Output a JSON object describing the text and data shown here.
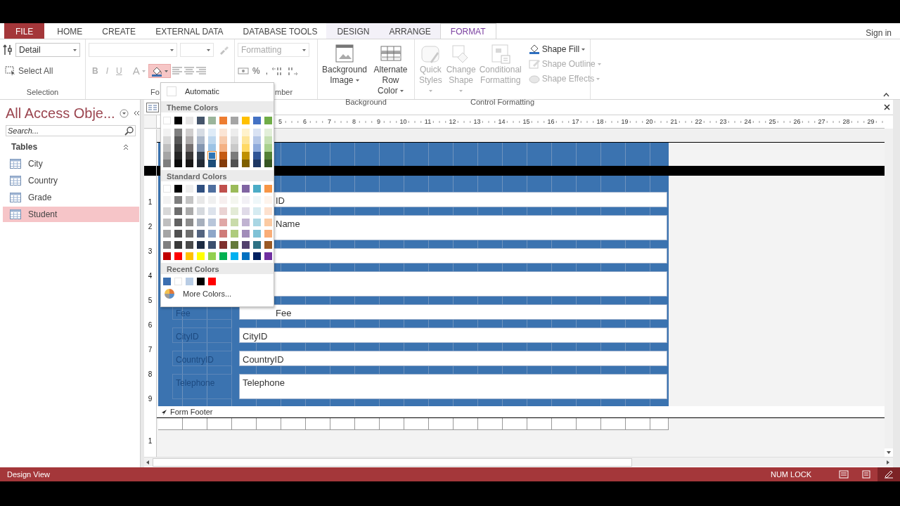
{
  "tabs": [
    {
      "label": "FILE",
      "kind": "file",
      "selected": false
    },
    {
      "label": "HOME",
      "kind": "main",
      "selected": false
    },
    {
      "label": "CREATE",
      "kind": "main",
      "selected": false
    },
    {
      "label": "EXTERNAL DATA",
      "kind": "main",
      "selected": false
    },
    {
      "label": "DATABASE TOOLS",
      "kind": "main",
      "selected": false
    },
    {
      "label": "DESIGN",
      "kind": "contextual",
      "selected": false
    },
    {
      "label": "ARRANGE",
      "kind": "contextual",
      "selected": false
    },
    {
      "label": "FORMAT",
      "kind": "contextual",
      "selected": true
    }
  ],
  "sign_in": "Sign in",
  "ribbon": {
    "selection": {
      "object": "Detail",
      "select_all": "Select All",
      "label": "Selection"
    },
    "font": {
      "label": "Fo",
      "disabled": true,
      "bold": "B",
      "italic": "I",
      "underline": "U",
      "font_color": "A",
      "fill_color_expanded": true
    },
    "number": {
      "label": "mber",
      "format_placeholder": "Formatting",
      "percent": "%",
      "comma": ","
    },
    "background": {
      "label": "Background",
      "buttons": [
        {
          "label": "Background Image"
        },
        {
          "label": "Alternate Row Color"
        }
      ]
    },
    "control_formatting": {
      "label": "Control Formatting",
      "large": [
        {
          "label": "Quick Styles",
          "disabled": true
        },
        {
          "label": "Change Shape",
          "disabled": true
        },
        {
          "label": "Conditional Formatting",
          "disabled": true
        }
      ],
      "small": [
        {
          "label": "Shape Fill",
          "disabled": false
        },
        {
          "label": "Shape Outline",
          "disabled": true
        },
        {
          "label": "Shape Effects",
          "disabled": true
        }
      ]
    }
  },
  "nav": {
    "title": "All Access Obje...",
    "search_placeholder": "Search...",
    "group": "Tables",
    "items": [
      {
        "label": "City",
        "selected": false
      },
      {
        "label": "Country",
        "selected": false
      },
      {
        "label": "Grade",
        "selected": false
      },
      {
        "label": "Student",
        "selected": true
      }
    ]
  },
  "designer": {
    "ruler_numbers": [
      "5",
      "6",
      "7",
      "8",
      "9",
      "10",
      "11",
      "12",
      "13",
      "14",
      "15",
      "16",
      "17",
      "18",
      "19",
      "20",
      "21",
      "22",
      "23",
      "24",
      "25",
      "26",
      "27",
      "28",
      "29"
    ],
    "vertical_ruler_detail": [
      "1",
      "2",
      "3",
      "4",
      "5",
      "6",
      "7",
      "8",
      "9"
    ],
    "vertical_ruler_footer": [
      "1"
    ],
    "fields": [
      {
        "kind": "text-box",
        "value": "ID"
      },
      {
        "kind": "text-box",
        "value": "Name"
      },
      {
        "kind": "text-box"
      },
      {
        "kind": "text-box"
      },
      {
        "kind": "text-box",
        "label": "Fee",
        "value": "Fee"
      },
      {
        "kind": "text-box",
        "label": "CityID",
        "value": "CityID"
      },
      {
        "kind": "text-box",
        "label": "CountryID",
        "value": "CountryID"
      },
      {
        "kind": "text-box",
        "label": "Telephone",
        "value": "Telephone"
      }
    ],
    "footer_label": "Form Footer"
  },
  "color_menu": {
    "automatic": "Automatic",
    "theme_heading": "Theme Colors",
    "theme_colors": [
      [
        {
          "color": "#ffffff",
          "selected": false
        },
        {
          "color": "#000000",
          "selected": false
        },
        {
          "color": "#e7e6e6",
          "selected": false
        },
        {
          "color": "#44546a",
          "selected": false
        },
        {
          "color": "#9bb59b",
          "selected": false
        },
        {
          "color": "#ed7d31",
          "selected": false
        },
        {
          "color": "#a5a5a5",
          "selected": false
        },
        {
          "color": "#ffc000",
          "selected": false
        },
        {
          "color": "#4472c4",
          "selected": false
        },
        {
          "color": "#70ad47",
          "selected": false
        }
      ],
      [
        {
          "color": "#f2f2f2",
          "selected": false
        },
        {
          "color": "#7f7f7f",
          "selected": false
        },
        {
          "color": "#d0cece",
          "selected": false
        },
        {
          "color": "#d6dce4",
          "selected": false
        },
        {
          "color": "#deebf7",
          "selected": false
        },
        {
          "color": "#fbe5d5",
          "selected": false
        },
        {
          "color": "#ededed",
          "selected": false
        },
        {
          "color": "#fff2cc",
          "selected": false
        },
        {
          "color": "#d9e2f3",
          "selected": false
        },
        {
          "color": "#e2efd9",
          "selected": false
        }
      ],
      [
        {
          "color": "#d9d9d9",
          "selected": false
        },
        {
          "color": "#595959",
          "selected": false
        },
        {
          "color": "#aeabab",
          "selected": false
        },
        {
          "color": "#adb9ca",
          "selected": false
        },
        {
          "color": "#bdd7ee",
          "selected": false
        },
        {
          "color": "#f7cbac",
          "selected": false
        },
        {
          "color": "#dbdbdb",
          "selected": false
        },
        {
          "color": "#fee599",
          "selected": false
        },
        {
          "color": "#b4c6e7",
          "selected": false
        },
        {
          "color": "#c5e0b3",
          "selected": false
        }
      ],
      [
        {
          "color": "#bfbfbf",
          "selected": false
        },
        {
          "color": "#3f3f3f",
          "selected": false
        },
        {
          "color": "#757070",
          "selected": false
        },
        {
          "color": "#8496b0",
          "selected": false
        },
        {
          "color": "#9cc3e5",
          "selected": false
        },
        {
          "color": "#f4b183",
          "selected": false
        },
        {
          "color": "#c9c9c9",
          "selected": false
        },
        {
          "color": "#ffd965",
          "selected": false
        },
        {
          "color": "#8eaadb",
          "selected": false
        },
        {
          "color": "#a8d08d",
          "selected": false
        }
      ],
      [
        {
          "color": "#a5a5a5",
          "selected": false
        },
        {
          "color": "#262626",
          "selected": false
        },
        {
          "color": "#3a3838",
          "selected": false
        },
        {
          "color": "#323f4f",
          "selected": false
        },
        {
          "color": "#2e75b5",
          "selected": true
        },
        {
          "color": "#c55a11",
          "selected": false
        },
        {
          "color": "#7b7b7b",
          "selected": false
        },
        {
          "color": "#bf9000",
          "selected": false
        },
        {
          "color": "#2f5496",
          "selected": false
        },
        {
          "color": "#538135",
          "selected": false
        }
      ],
      [
        {
          "color": "#7f7f7f",
          "selected": false
        },
        {
          "color": "#0c0c0c",
          "selected": false
        },
        {
          "color": "#171616",
          "selected": false
        },
        {
          "color": "#222a35",
          "selected": false
        },
        {
          "color": "#1e4e79",
          "selected": false
        },
        {
          "color": "#833c0b",
          "selected": false
        },
        {
          "color": "#525252",
          "selected": false
        },
        {
          "color": "#7f6000",
          "selected": false
        },
        {
          "color": "#1f3864",
          "selected": false
        },
        {
          "color": "#375623",
          "selected": false
        }
      ]
    ],
    "standard_heading": "Standard Colors",
    "standard_colors": [
      [
        {
          "color": "#ffffff"
        },
        {
          "color": "#000000"
        },
        {
          "color": "#eeeeee"
        },
        {
          "color": "#2f4f7f"
        },
        {
          "color": "#4f6f9f"
        },
        {
          "color": "#c0504d"
        },
        {
          "color": "#9bbb59"
        },
        {
          "color": "#8064a2"
        },
        {
          "color": "#4bacc6"
        },
        {
          "color": "#f79646"
        }
      ],
      [
        {
          "color": "#f2f2f2"
        },
        {
          "color": "#7f7f7f"
        },
        {
          "color": "#c4c4c4"
        },
        {
          "color": "#e8e8e8"
        },
        {
          "color": "#f0f0f0"
        },
        {
          "color": "#f7efef"
        },
        {
          "color": "#f4f6ef"
        },
        {
          "color": "#f2f0f5"
        },
        {
          "color": "#eef7f9"
        },
        {
          "color": "#fef4ec"
        }
      ],
      [
        {
          "color": "#d8d8d8"
        },
        {
          "color": "#6e6e6e"
        },
        {
          "color": "#aaaaaa"
        },
        {
          "color": "#d5d9de"
        },
        {
          "color": "#dde3ec"
        },
        {
          "color": "#ead3d3"
        },
        {
          "color": "#e3ebd6"
        },
        {
          "color": "#e0dbe8"
        },
        {
          "color": "#d5ebf1"
        },
        {
          "color": "#fde1ce"
        }
      ],
      [
        {
          "color": "#bfbfbf"
        },
        {
          "color": "#626262"
        },
        {
          "color": "#8c8c8c"
        },
        {
          "color": "#a6afbc"
        },
        {
          "color": "#b8c6da"
        },
        {
          "color": "#dfa7a6"
        },
        {
          "color": "#c9dbaa"
        },
        {
          "color": "#c0b3d1"
        },
        {
          "color": "#a9d6e3"
        },
        {
          "color": "#fbcaa2"
        }
      ],
      [
        {
          "color": "#a5a5a5"
        },
        {
          "color": "#505050"
        },
        {
          "color": "#6e6e6e"
        },
        {
          "color": "#536480"
        },
        {
          "color": "#8ea6c8"
        },
        {
          "color": "#cf7b79"
        },
        {
          "color": "#aecb7c"
        },
        {
          "color": "#a18cb9"
        },
        {
          "color": "#7fc2d6"
        },
        {
          "color": "#f9ad76"
        }
      ],
      [
        {
          "color": "#7f7f7f"
        },
        {
          "color": "#3a3a3a"
        },
        {
          "color": "#4a4a4a"
        },
        {
          "color": "#1d2b43"
        },
        {
          "color": "#3c4f6e"
        },
        {
          "color": "#7f302e"
        },
        {
          "color": "#647a3a"
        },
        {
          "color": "#52406d"
        },
        {
          "color": "#2d7285"
        },
        {
          "color": "#9a5a24"
        }
      ],
      [
        {
          "color": "#c00000"
        },
        {
          "color": "#ff0000"
        },
        {
          "color": "#ffc000"
        },
        {
          "color": "#ffff00"
        },
        {
          "color": "#92d050"
        },
        {
          "color": "#00b050"
        },
        {
          "color": "#00b0f0"
        },
        {
          "color": "#0070c0"
        },
        {
          "color": "#002060"
        },
        {
          "color": "#7030a0"
        }
      ]
    ],
    "recent_heading": "Recent Colors",
    "recent_colors": [
      {
        "color": "#3b6fb0"
      },
      {
        "color": "#ffffff"
      },
      {
        "color": "#b8cce4"
      },
      {
        "color": "#000000"
      },
      {
        "color": "#ff0000"
      }
    ],
    "more": "More Colors..."
  },
  "status_bar": {
    "mode": "Design View",
    "num_lock": "NUM LOCK",
    "views": [
      {
        "selected": false
      },
      {
        "selected": false
      },
      {
        "selected": true
      }
    ]
  }
}
